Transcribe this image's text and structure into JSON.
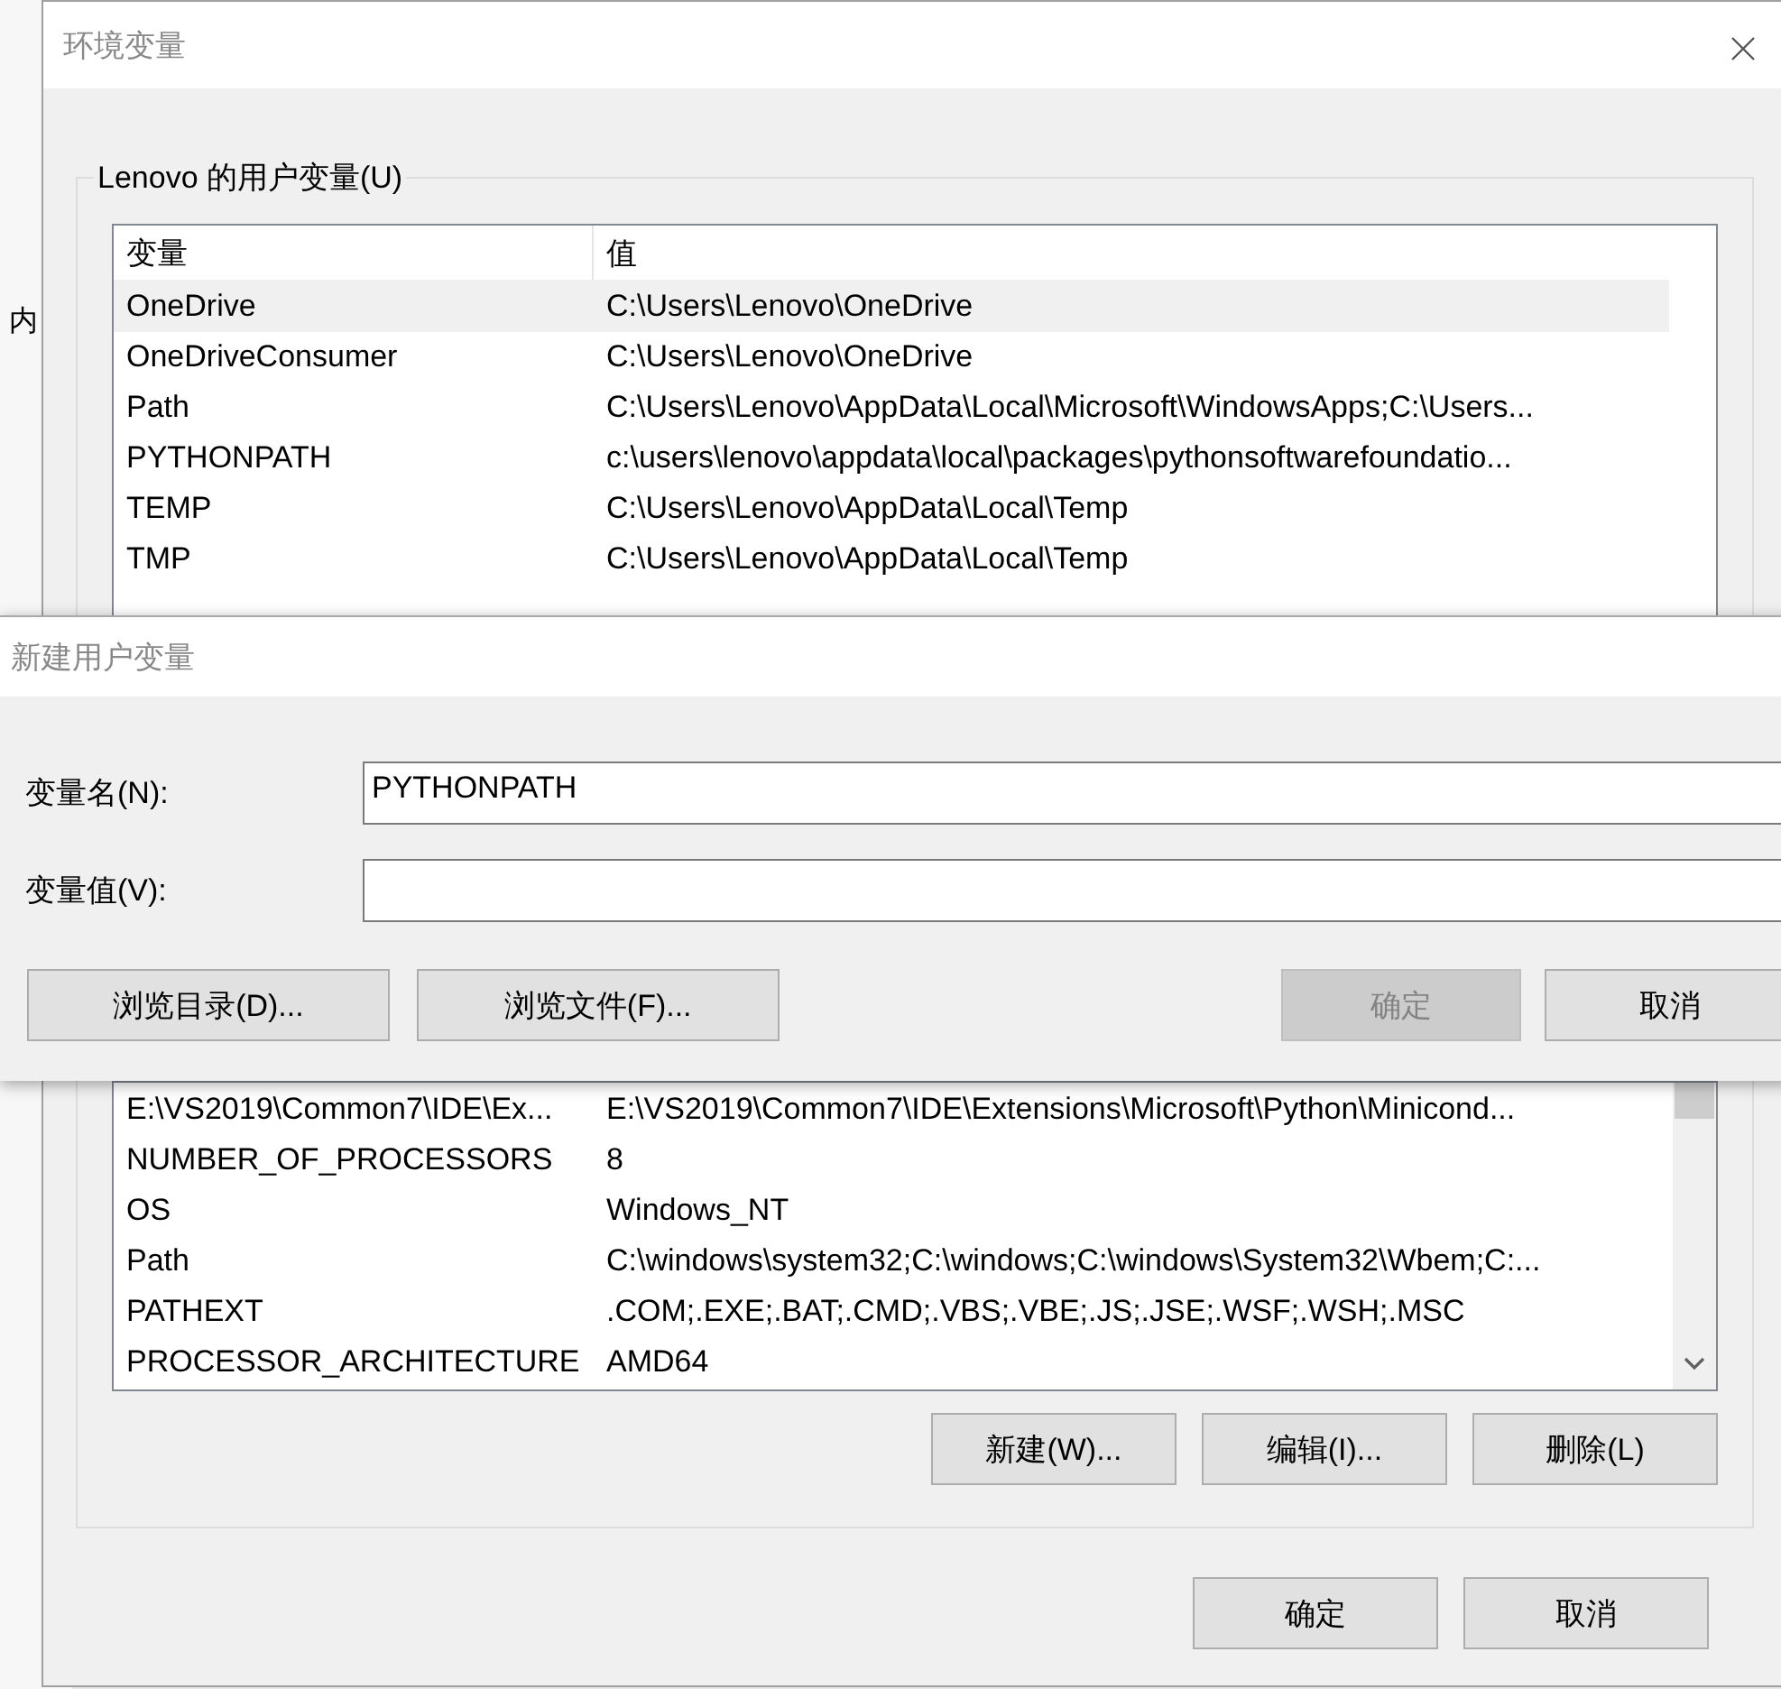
{
  "background_window": {
    "text": "内"
  },
  "env_dialog": {
    "title": "环境变量",
    "user_group": {
      "label": "Lenovo 的用户变量(U)",
      "columns": [
        "变量",
        "值"
      ],
      "rows": [
        {
          "name": "OneDrive",
          "value": "C:\\Users\\Lenovo\\OneDrive",
          "selected": true
        },
        {
          "name": "OneDriveConsumer",
          "value": "C:\\Users\\Lenovo\\OneDrive",
          "selected": false
        },
        {
          "name": "Path",
          "value": "C:\\Users\\Lenovo\\AppData\\Local\\Microsoft\\WindowsApps;C:\\Users...",
          "selected": false
        },
        {
          "name": "PYTHONPATH",
          "value": "c:\\users\\lenovo\\appdata\\local\\packages\\pythonsoftwarefoundatio...",
          "selected": false
        },
        {
          "name": "TEMP",
          "value": "C:\\Users\\Lenovo\\AppData\\Local\\Temp",
          "selected": false
        },
        {
          "name": "TMP",
          "value": "C:\\Users\\Lenovo\\AppData\\Local\\Temp",
          "selected": false
        }
      ]
    },
    "system_rows": [
      {
        "name": "E:\\VS2019\\Common7\\IDE\\Ex...",
        "value": "E:\\VS2019\\Common7\\IDE\\Extensions\\Microsoft\\Python\\Minicond...",
        "selected": false
      },
      {
        "name": "NUMBER_OF_PROCESSORS",
        "value": "8",
        "selected": false
      },
      {
        "name": "OS",
        "value": "Windows_NT",
        "selected": false
      },
      {
        "name": "Path",
        "value": "C:\\windows\\system32;C:\\windows;C:\\windows\\System32\\Wbem;C:...",
        "selected": false
      },
      {
        "name": "PATHEXT",
        "value": ".COM;.EXE;.BAT;.CMD;.VBS;.VBE;.JS;.JSE;.WSF;.WSH;.MSC",
        "selected": false
      },
      {
        "name": "PROCESSOR_ARCHITECTURE",
        "value": "AMD64",
        "selected": false
      }
    ],
    "list_buttons": [
      "新建(W)...",
      "编辑(I)...",
      "删除(L)"
    ],
    "buttons": [
      "确定",
      "取消"
    ]
  },
  "new_var_dialog": {
    "title": "新建用户变量",
    "fields": [
      {
        "label": "变量名(N):",
        "value": "PYTHONPATH"
      },
      {
        "label": "变量值(V):"
      }
    ],
    "buttons": [
      {
        "label": "浏览目录(D)...",
        "disabled": false
      },
      {
        "label": "浏览文件(F)...",
        "disabled": false
      },
      {
        "label": "确定",
        "disabled": true
      },
      {
        "label": "取消",
        "disabled": false
      }
    ]
  }
}
